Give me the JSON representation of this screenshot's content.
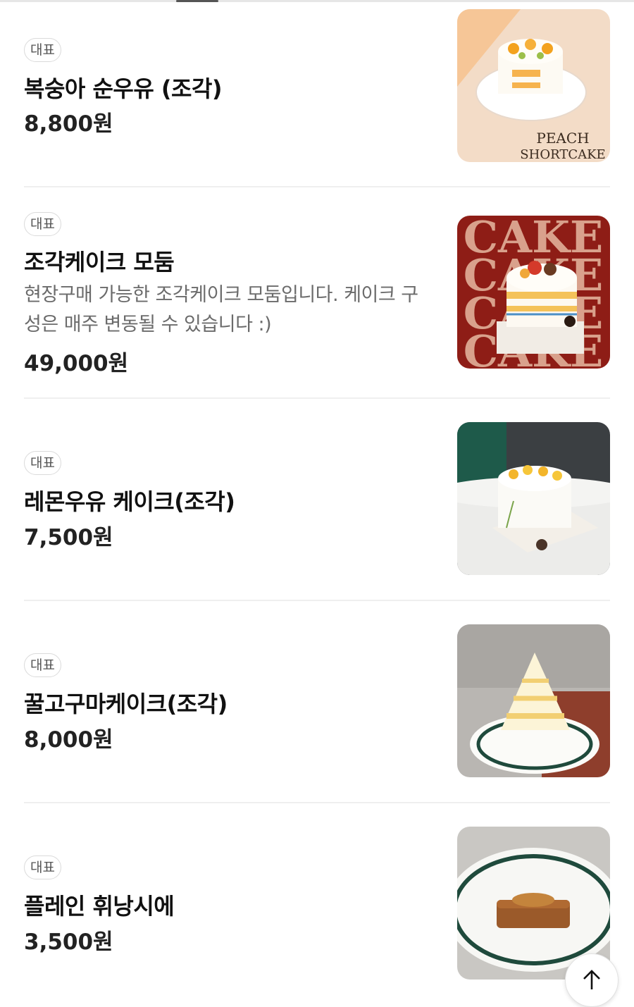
{
  "items": [
    {
      "badge": "대표",
      "name": "복숭아 순우유 (조각)",
      "description": "",
      "price": "8,800원",
      "image_text": [
        "PEACH",
        "SHORTCAKE"
      ]
    },
    {
      "badge": "대표",
      "name": "조각케이크 모둠",
      "description": "현장구매 가능한 조각케이크 모둠입니다. 케이크 구성은 매주 변동될 수 있습니다 :)",
      "price": "49,000원",
      "image_text": [
        "CAKE",
        "CAKE",
        "CAKE",
        "CAKE"
      ]
    },
    {
      "badge": "대표",
      "name": "레몬우유 케이크(조각)",
      "description": "",
      "price": "7,500원",
      "image_text": []
    },
    {
      "badge": "대표",
      "name": "꿀고구마케이크(조각)",
      "description": "",
      "price": "8,000원",
      "image_text": []
    },
    {
      "badge": "대표",
      "name": "플레인 휘낭시에",
      "description": "",
      "price": "3,500원",
      "image_text": []
    }
  ],
  "scroll_top_icon": "arrow-up-icon",
  "colors": {
    "text": "#111111",
    "muted": "#6b6b6b",
    "badge_border": "#dadada",
    "divider": "#efefef"
  }
}
